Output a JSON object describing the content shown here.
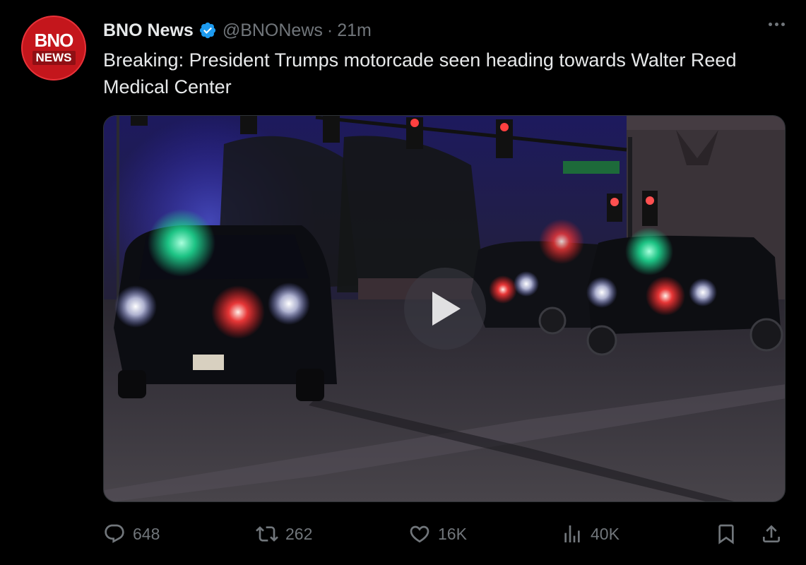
{
  "author": {
    "avatar_line1": "BNO",
    "avatar_line2": "NEWS",
    "display_name": "BNO News",
    "handle": "@BNONews",
    "separator": "·",
    "time": "21m"
  },
  "tweet": {
    "text": "Breaking: President Trumps motorcade seen heading towards Walter Reed Medical Center"
  },
  "media": {
    "type": "video",
    "play_icon": "play-icon"
  },
  "actions": {
    "replies": "648",
    "retweets": "262",
    "likes": "16K",
    "views": "40K"
  },
  "colors": {
    "background": "#000000",
    "text": "#e7e9ea",
    "secondary": "#71767b",
    "verified": "#1d9bf0",
    "brand_red": "#c4161c"
  }
}
